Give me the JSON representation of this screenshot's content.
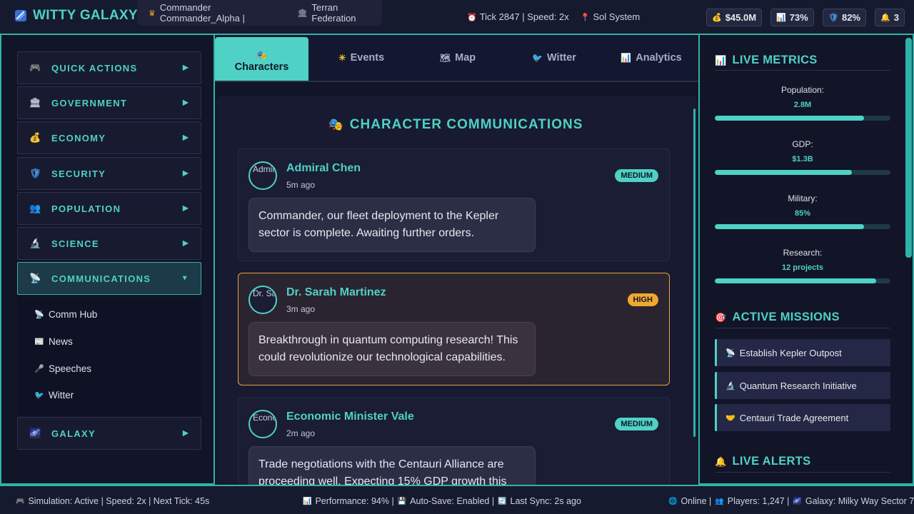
{
  "header": {
    "app_title": "WITTY GALAXY",
    "commander": "Commander Commander_Alpha |",
    "faction": "Terran Federation",
    "tick": "Tick 2847 | Speed: 2x",
    "system": "Sol System",
    "stats": {
      "credits": "$45.0M",
      "approval": "73%",
      "security": "82%",
      "alerts": "3"
    }
  },
  "sidebar": {
    "items": [
      {
        "label": "QUICK ACTIONS",
        "icon": "gamepad-icon"
      },
      {
        "label": "GOVERNMENT",
        "icon": "government-icon"
      },
      {
        "label": "ECONOMY",
        "icon": "money-bag-icon"
      },
      {
        "label": "SECURITY",
        "icon": "shield-icon"
      },
      {
        "label": "POPULATION",
        "icon": "people-icon"
      },
      {
        "label": "SCIENCE",
        "icon": "microscope-icon"
      },
      {
        "label": "COMMUNICATIONS",
        "icon": "satellite-icon"
      },
      {
        "label": "GALAXY",
        "icon": "galaxy-icon"
      }
    ],
    "sub_items": [
      {
        "label": "Comm Hub",
        "icon": "satellite-icon"
      },
      {
        "label": "News",
        "icon": "newspaper-icon"
      },
      {
        "label": "Speeches",
        "icon": "microphone-icon"
      },
      {
        "label": "Witter",
        "icon": "bird-icon"
      }
    ]
  },
  "tabs": [
    {
      "label": "Characters",
      "icon": "masks-icon"
    },
    {
      "label": "Events",
      "icon": "sun-icon"
    },
    {
      "label": "Map",
      "icon": "map-icon"
    },
    {
      "label": "Witter",
      "icon": "bird-icon"
    },
    {
      "label": "Analytics",
      "icon": "chart-icon"
    }
  ],
  "panel": {
    "title": "CHARACTER COMMUNICATIONS",
    "messages": [
      {
        "name": "Admiral Chen",
        "time": "5m ago",
        "priority": "MEDIUM",
        "avatar_alt": "Admiral Chen",
        "text": "Commander, our fleet deployment to the Kepler sector is complete. Awaiting further orders."
      },
      {
        "name": "Dr. Sarah Martinez",
        "time": "3m ago",
        "priority": "HIGH",
        "avatar_alt": "Dr. Sarah Martinez",
        "text": "Breakthrough in quantum computing research! This could revolutionize our technological capabilities."
      },
      {
        "name": "Economic Minister Vale",
        "time": "2m ago",
        "priority": "MEDIUM",
        "avatar_alt": "Economic Minister Vale",
        "text": "Trade negotiations with the Centauri Alliance are proceeding well. Expecting 15% GDP growth this"
      }
    ]
  },
  "right": {
    "metrics_title": "LIVE METRICS",
    "metrics": [
      {
        "label": "Population:",
        "value": "2.8M",
        "fill": 0.85
      },
      {
        "label": "GDP:",
        "value": "$1.3B",
        "fill": 0.78
      },
      {
        "label": "Military:",
        "value": "85%",
        "fill": 0.85
      },
      {
        "label": "Research:",
        "value": "12 projects",
        "fill": 0.92
      }
    ],
    "missions_title": "ACTIVE MISSIONS",
    "missions": [
      {
        "label": "Establish Kepler Outpost",
        "icon": "satellite-icon"
      },
      {
        "label": "Quantum Research Initiative",
        "icon": "microscope-icon"
      },
      {
        "label": "Centauri Trade Agreement",
        "icon": "handshake-icon"
      }
    ],
    "alerts_title": "LIVE ALERTS"
  },
  "footer": {
    "simulation": "Simulation: Active | Speed: 2x | Next Tick: 45s",
    "performance": "Performance: 94% |",
    "autosave": "Auto-Save: Enabled |",
    "sync": "Last Sync: 2s ago",
    "online": "Online |",
    "players": "Players: 1,247 |",
    "galaxy": "Galaxy: Milky Way Sector 7"
  },
  "colors": {
    "accent": "#4fd1c5",
    "background": "#121427",
    "high_priority": "#f0a830"
  }
}
